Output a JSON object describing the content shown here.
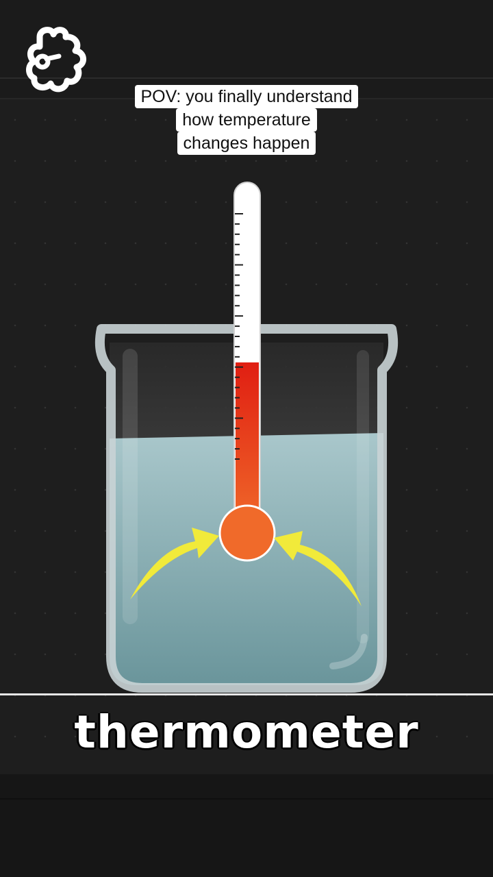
{
  "caption": {
    "line1": "POV: you finally understand",
    "line2": "how temperature",
    "line3": "changes happen"
  },
  "label": "thermometer",
  "icons": {
    "logo": "puzzle-brain-logo-icon",
    "arrow_left": "curved-arrow-right-icon",
    "arrow_right": "curved-arrow-left-icon"
  },
  "colors": {
    "background": "#1c1c1c",
    "water": "#7fa9ae",
    "mercury_top": "#e01e12",
    "mercury_bottom": "#f06a2a",
    "arrow": "#f1ea3a",
    "caption_bg": "#ffffff"
  },
  "thermometer_level": 0.49
}
